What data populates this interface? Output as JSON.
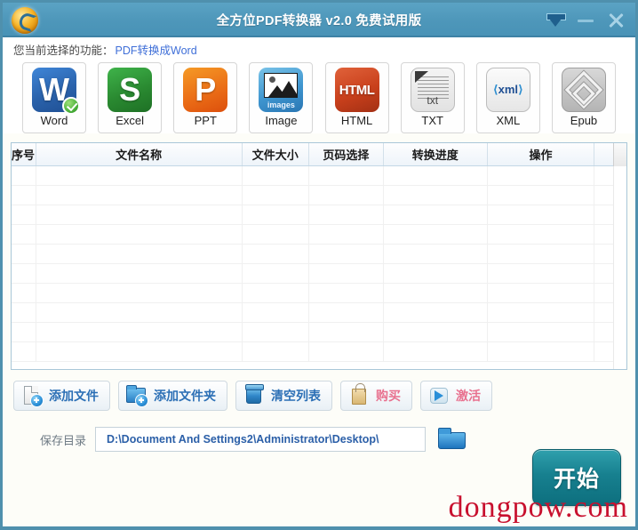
{
  "window": {
    "title": "全方位PDF转换器 v2.0 免费试用版",
    "logo_icon": "flame-logo-icon",
    "controls": [
      {
        "name": "minimize-to-tray-button",
        "icon": "tray-arrow-down-icon",
        "label": ""
      },
      {
        "name": "minimize-button",
        "icon": "minimize-dash-icon",
        "label": ""
      },
      {
        "name": "close-button",
        "icon": "close-x-icon",
        "label": ""
      }
    ]
  },
  "function_line": {
    "label": "您当前选择的功能：",
    "value": "PDF转换成Word"
  },
  "formats": [
    {
      "label": "Word",
      "icon": "word-icon",
      "glyph": "W",
      "selected": true
    },
    {
      "label": "Excel",
      "icon": "excel-icon",
      "glyph": "S",
      "selected": false
    },
    {
      "label": "PPT",
      "icon": "ppt-icon",
      "glyph": "P",
      "selected": false
    },
    {
      "label": "Image",
      "icon": "image-icon",
      "glyph": "images",
      "selected": false
    },
    {
      "label": "HTML",
      "icon": "html-icon",
      "glyph": "HTML",
      "selected": false
    },
    {
      "label": "TXT",
      "icon": "txt-icon",
      "glyph": "txt",
      "selected": false
    },
    {
      "label": "XML",
      "icon": "xml-icon",
      "glyph": "xml",
      "selected": false
    },
    {
      "label": "Epub",
      "icon": "epub-icon",
      "glyph": "",
      "selected": false
    }
  ],
  "table": {
    "columns": [
      "序号",
      "文件名称",
      "文件大小",
      "页码选择",
      "转换进度",
      "操作"
    ],
    "rows": [],
    "empty_row_count": 10
  },
  "actions": [
    {
      "label": "添加文件",
      "icon": "add-file-icon",
      "style": "blue"
    },
    {
      "label": "添加文件夹",
      "icon": "add-folder-icon",
      "style": "blue"
    },
    {
      "label": "清空列表",
      "icon": "trash-icon",
      "style": "blue"
    },
    {
      "label": "购买",
      "icon": "shopping-bag-icon",
      "style": "pink"
    },
    {
      "label": "激活",
      "icon": "activate-arrow-icon",
      "style": "pink"
    }
  ],
  "save": {
    "label": "保存目录",
    "path": "D:\\Document And Settings2\\Administrator\\Desktop\\",
    "browse_icon": "folder-icon"
  },
  "start": {
    "label": "开始"
  },
  "watermark": {
    "text": "dongpow.com"
  },
  "colors": {
    "titlebar": "#4e97ba",
    "frame_border": "#4f90ad",
    "accent_blue": "#3f6fd8",
    "action_text": "#2b6fb5",
    "pink_text": "#e8718f",
    "start_button": "#17808f",
    "watermark": "#c8102e"
  }
}
